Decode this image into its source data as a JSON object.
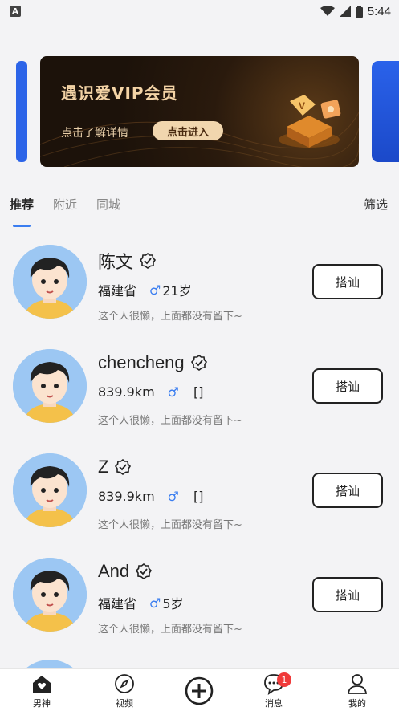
{
  "status_bar": {
    "time": "5:44",
    "left_icon": "A"
  },
  "banner": {
    "title": "遇识爱VIP会员",
    "subtitle": "点击了解详情",
    "button": "点击进入"
  },
  "tabs": [
    {
      "label": "推荐",
      "active": true
    },
    {
      "label": "附近",
      "active": false
    },
    {
      "label": "同城",
      "active": false
    }
  ],
  "filter_label": "筛选",
  "users": [
    {
      "name": "陈文",
      "location": "福建省",
      "gender": "♂",
      "age": "21岁",
      "extra": "",
      "bio": "这个人很懒，上面都没有留下~",
      "action": "搭讪"
    },
    {
      "name": "chencheng",
      "location": "839.9km",
      "gender": "♂",
      "age": "",
      "extra": "[]",
      "bio": "这个人很懒，上面都没有留下~",
      "action": "搭讪"
    },
    {
      "name": "Z",
      "location": "839.9km",
      "gender": "♂",
      "age": "",
      "extra": "[]",
      "bio": "这个人很懒，上面都没有留下~",
      "action": "搭讪"
    },
    {
      "name": "And",
      "location": "福建省",
      "gender": "♂",
      "age": "5岁",
      "extra": "",
      "bio": "这个人很懒，上面都没有留下~",
      "action": "搭讪"
    }
  ],
  "bottom_nav": [
    {
      "label": "男神",
      "icon": "heart-house-icon",
      "badge": ""
    },
    {
      "label": "视频",
      "icon": "compass-icon",
      "badge": ""
    },
    {
      "label": "",
      "icon": "plus-circle-icon",
      "badge": ""
    },
    {
      "label": "消息",
      "icon": "chat-icon",
      "badge": "1"
    },
    {
      "label": "我的",
      "icon": "person-icon",
      "badge": ""
    }
  ],
  "colors": {
    "accent": "#3a7df0",
    "badge": "#f03b3b",
    "banner_gold": "#f3d3a5"
  }
}
